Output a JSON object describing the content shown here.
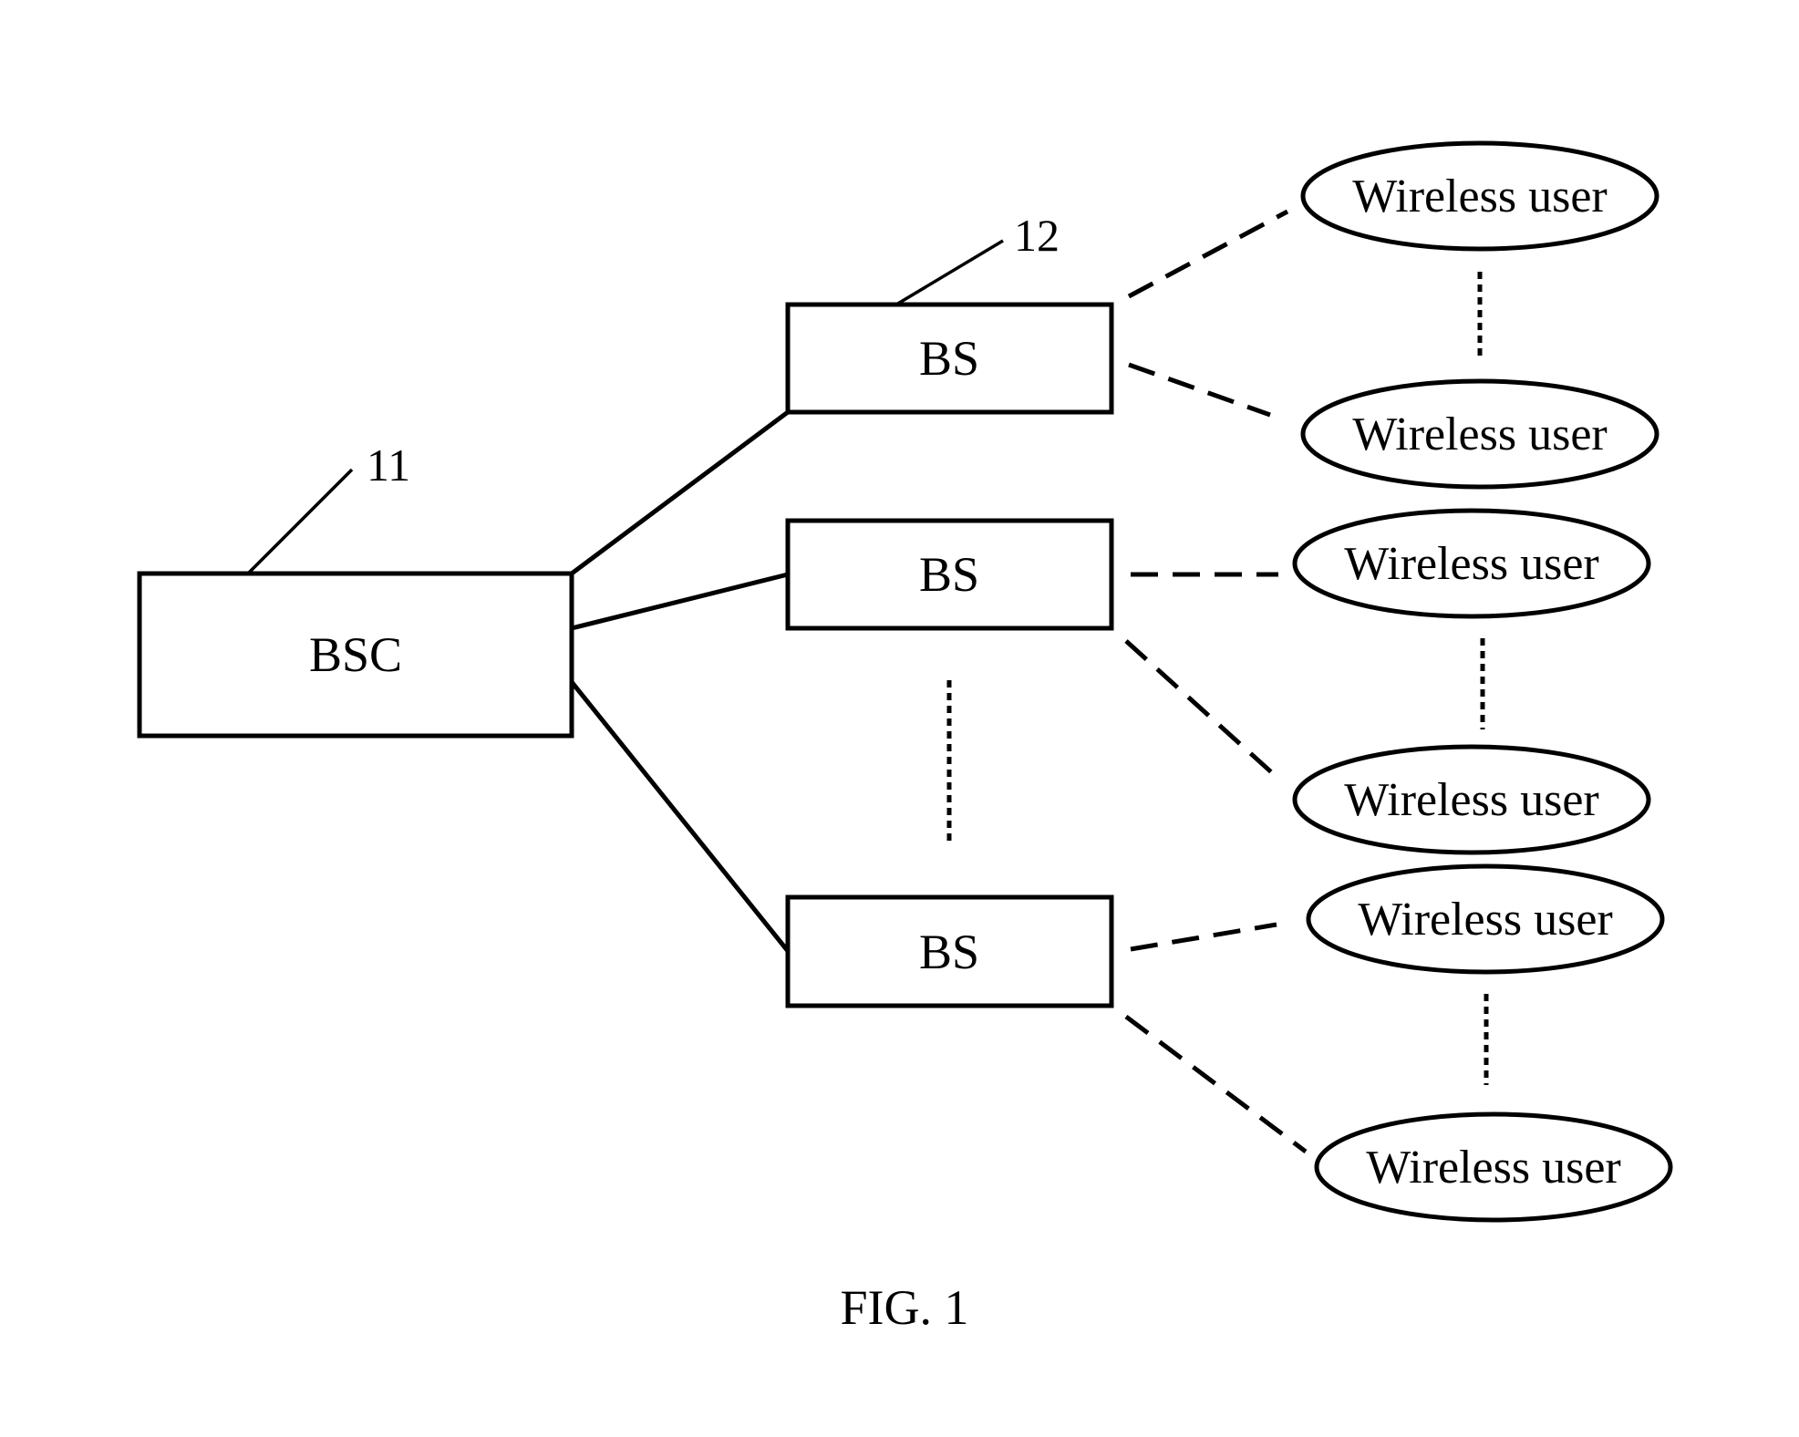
{
  "figure": {
    "caption": "FIG. 1",
    "controller": {
      "label": "BSC",
      "ref": "11"
    },
    "base_stations": [
      {
        "label": "BS",
        "ref": "12"
      },
      {
        "label": "BS"
      },
      {
        "label": "BS"
      }
    ],
    "wireless_users": [
      {
        "label": "Wireless user"
      },
      {
        "label": "Wireless user"
      },
      {
        "label": "Wireless user"
      },
      {
        "label": "Wireless user"
      },
      {
        "label": "Wireless user"
      },
      {
        "label": "Wireless user"
      }
    ],
    "connections": {
      "bsc_to_bs": "solid",
      "bs_to_user": "dashed",
      "ellipsis": "dotted"
    }
  }
}
